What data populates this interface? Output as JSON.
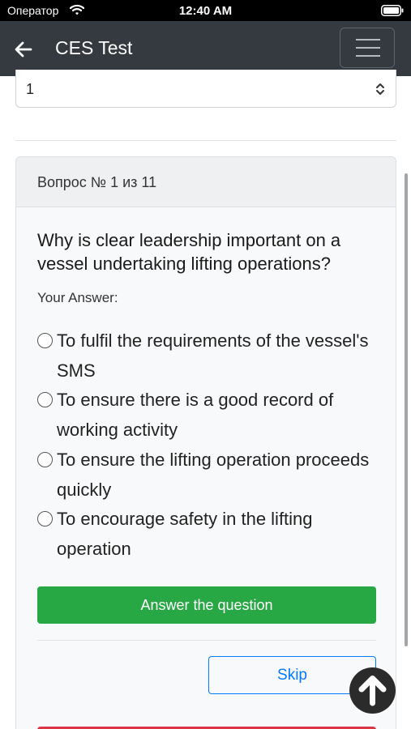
{
  "status_bar": {
    "carrier": "Оператор",
    "time": "12:40 AM"
  },
  "navbar": {
    "title": "CES Test"
  },
  "selector": {
    "value": "1"
  },
  "card": {
    "counter": "Вопрос № 1 из 11",
    "question": "Why is clear leadership important on a vessel undertaking lifting operations?",
    "answer_label": "Your Answer:",
    "options": [
      {
        "label": "To fulfil the requirements of the vessel's SMS"
      },
      {
        "label": "To ensure there is a good record of working activity"
      },
      {
        "label": "To ensure the lifting operation proceeds quickly"
      },
      {
        "label": "To encourage safety in the lifting operation"
      }
    ],
    "answer_button": "Answer the question",
    "skip_button": "Skip"
  },
  "colors": {
    "navbar": "#343a40",
    "success": "#28a745",
    "primary": "#007bff",
    "danger": "#dc3545"
  },
  "icons": [
    "wifi-icon",
    "battery-icon",
    "back-arrow-icon",
    "hamburger-menu-icon",
    "select-updown-icon",
    "arrow-up-icon"
  ]
}
